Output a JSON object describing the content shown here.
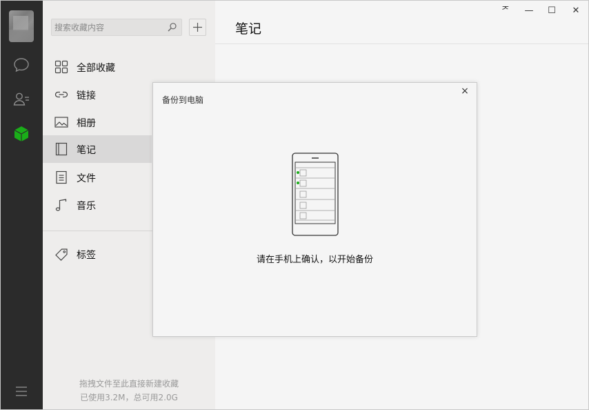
{
  "sidebar": {
    "icons": [
      "chat-icon",
      "contacts-icon",
      "favorites-icon",
      "menu-icon"
    ],
    "accent_color": "#1aad19"
  },
  "category_panel": {
    "search_placeholder": "搜索收藏内容",
    "items": [
      {
        "label": "全部收藏",
        "icon": "grid-icon"
      },
      {
        "label": "链接",
        "icon": "link-icon"
      },
      {
        "label": "相册",
        "icon": "image-icon"
      },
      {
        "label": "笔记",
        "icon": "note-icon",
        "active": true
      },
      {
        "label": "文件",
        "icon": "file-icon"
      },
      {
        "label": "音乐",
        "icon": "music-icon"
      },
      {
        "label": "标签",
        "icon": "tag-icon"
      }
    ],
    "footer_hint": "拖拽文件至此直接新建收藏",
    "storage_info": "已使用3.2M，总可用2.0G"
  },
  "main": {
    "title": "笔记"
  },
  "window_controls": {
    "pin": "ᅎ",
    "minimize": "—",
    "maximize": "☐",
    "close": "✕"
  },
  "modal": {
    "title": "备份到电脑",
    "close": "×",
    "message": "请在手机上确认，以开始备份"
  }
}
